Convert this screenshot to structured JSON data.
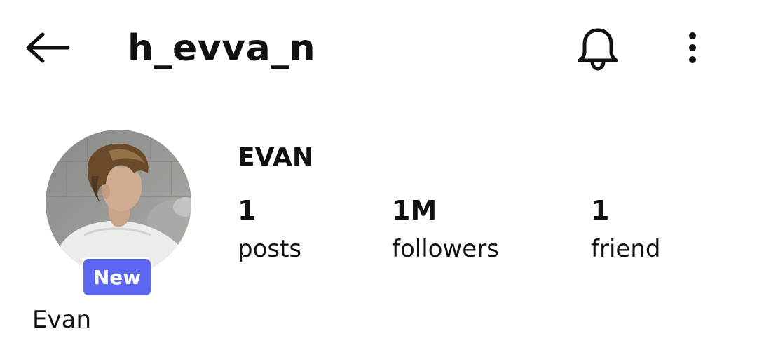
{
  "header": {
    "username": "h_evva_n",
    "back_icon": "arrow-left-icon",
    "bell_icon": "bell-icon",
    "more_icon": "more-vertical-icon"
  },
  "profile": {
    "avatar_icon": "profile-photo",
    "badge": "New",
    "name": "Evan",
    "display_name": "EVAN"
  },
  "stats": [
    {
      "count": "1",
      "label": "posts"
    },
    {
      "count": "1M",
      "label": "followers"
    },
    {
      "count": "1",
      "label": "friend"
    }
  ],
  "colors": {
    "badge_bg": "#5b67f1",
    "text": "#111111",
    "background": "#ffffff"
  }
}
